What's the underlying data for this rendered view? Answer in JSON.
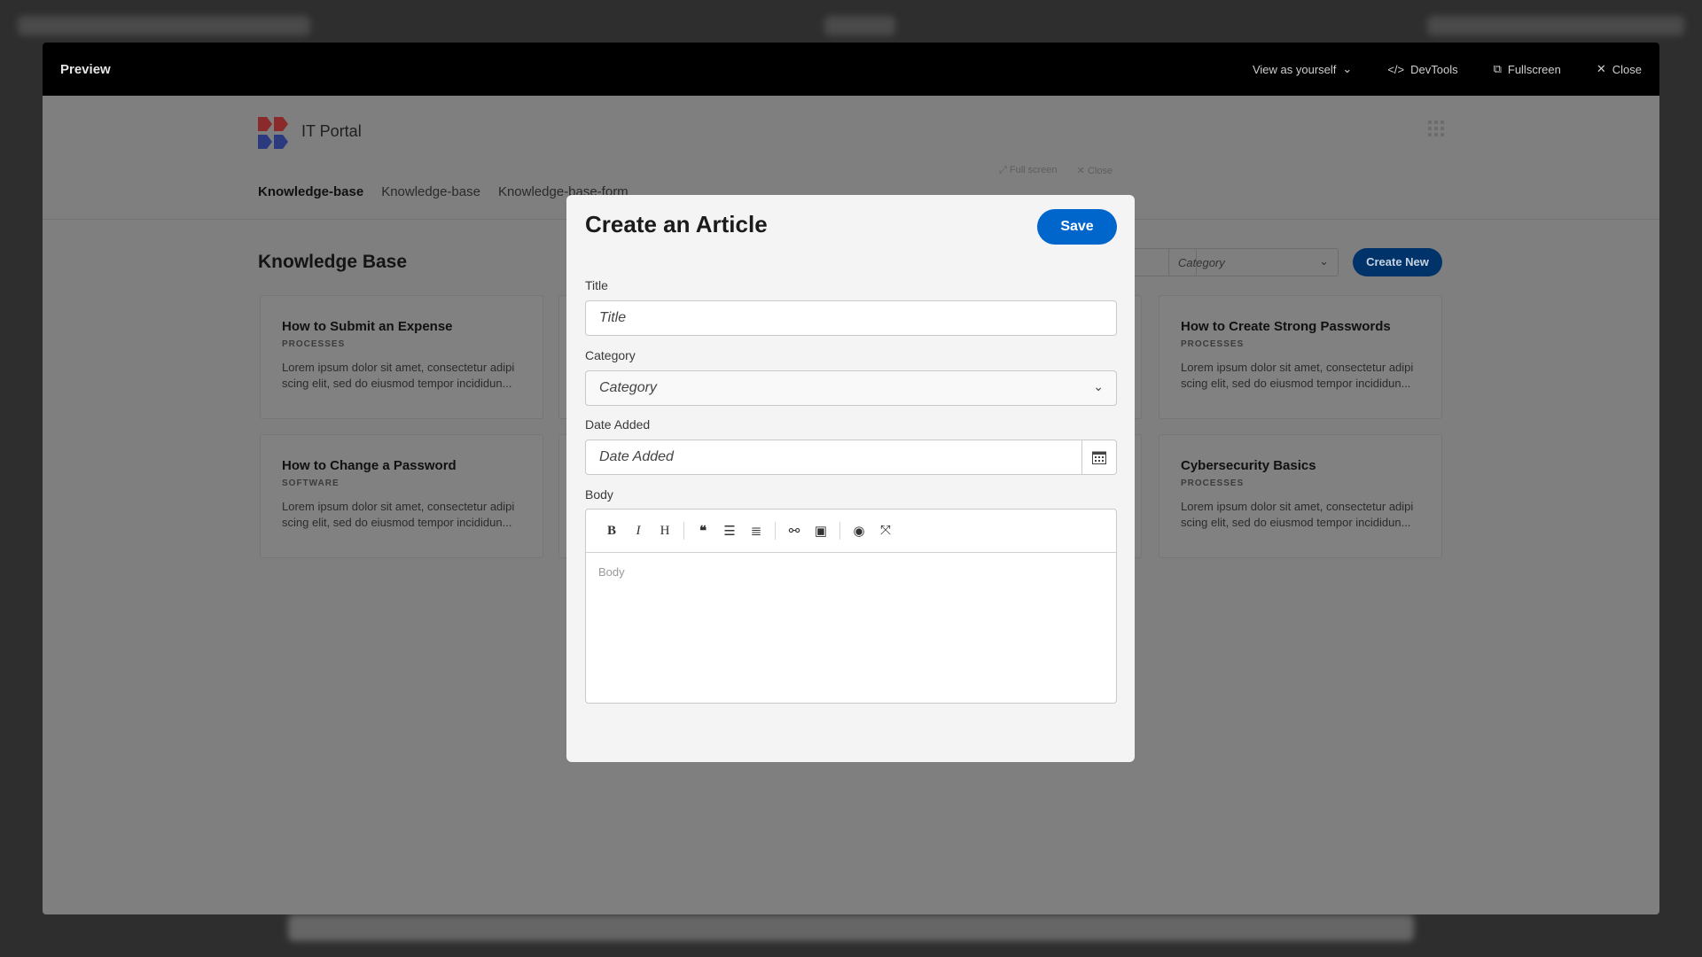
{
  "preview_bar": {
    "title": "Preview",
    "view_as": "View as yourself",
    "devtools": "DevTools",
    "fullscreen": "Fullscreen",
    "close": "Close"
  },
  "app": {
    "title": "IT Portal",
    "nav": [
      "Knowledge-base",
      "Knowledge-base",
      "Knowledge-base-form"
    ],
    "modal_tools": {
      "fullscreen": "Full screen",
      "close": "Close"
    }
  },
  "page": {
    "heading": "Knowledge Base",
    "category_filter": "Category",
    "create_button": "Create New",
    "cards": [
      {
        "title": "How to Submit an Expense",
        "category": "PROCESSES",
        "excerpt": "Lorem ipsum dolor sit amet, consectetur adipi scing elit, sed do eiusmod tempor incididun..."
      },
      {
        "title": "How to Create Strong Passwords",
        "category": "PROCESSES",
        "excerpt": "Lorem ipsum dolor sit amet, consectetur adipi scing elit, sed do eiusmod tempor incididun..."
      },
      {
        "title": "How to Change a Password",
        "category": "SOFTWARE",
        "excerpt": "Lorem ipsum dolor sit amet, consectetur adipi scing elit, sed do eiusmod tempor incididun..."
      },
      {
        "title": "Cybersecurity Basics",
        "category": "PROCESSES",
        "excerpt": "Lorem ipsum dolor sit amet, consectetur adipi scing elit, sed do eiusmod tempor incididun..."
      }
    ]
  },
  "modal": {
    "title": "Create an Article",
    "save": "Save",
    "fields": {
      "title_label": "Title",
      "title_placeholder": "Title",
      "category_label": "Category",
      "category_placeholder": "Category",
      "date_label": "Date Added",
      "date_placeholder": "Date Added",
      "body_label": "Body",
      "body_placeholder": "Body"
    },
    "toolbar": [
      "bold",
      "italic",
      "heading",
      "quote",
      "bullet-list",
      "numbered-list",
      "link",
      "image",
      "preview",
      "fullscreen"
    ]
  },
  "colors": {
    "accent": "#0066cc",
    "create_new": "#00336a"
  }
}
